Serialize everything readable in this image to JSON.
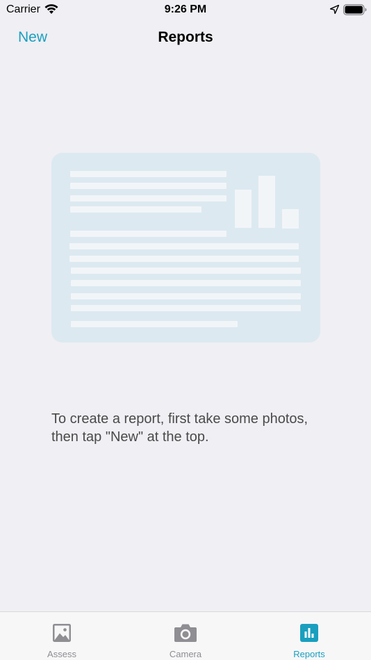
{
  "status_bar": {
    "carrier": "Carrier",
    "time": "9:26 PM"
  },
  "nav": {
    "new_label": "New",
    "title": "Reports"
  },
  "empty_state": {
    "message": "To create a report, first take some photos, then tap \"New\" at the top."
  },
  "tabs": [
    {
      "label": "Assess",
      "icon": "photo-icon",
      "active": false
    },
    {
      "label": "Camera",
      "icon": "camera-icon",
      "active": false
    },
    {
      "label": "Reports",
      "icon": "chart-icon",
      "active": true
    }
  ],
  "colors": {
    "accent": "#1a9fbf",
    "inactive": "#8e8e93",
    "background": "#efeff4",
    "illustration": "#dce9f0"
  }
}
